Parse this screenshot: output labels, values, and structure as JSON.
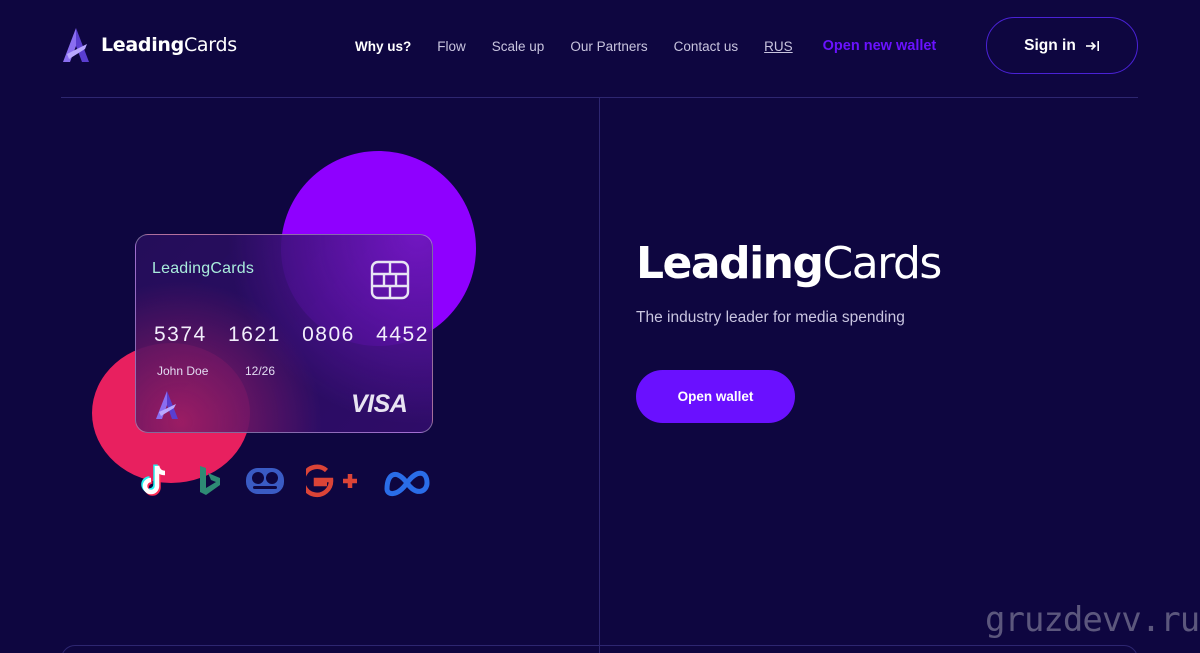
{
  "header": {
    "logo": {
      "name_bold": "Leading",
      "name_regular": "Cards"
    },
    "nav": [
      {
        "label": "Why us?"
      },
      {
        "label": "Flow"
      },
      {
        "label": "Scale up"
      },
      {
        "label": "Our Partners"
      },
      {
        "label": "Contact us"
      },
      {
        "label": "RUS"
      },
      {
        "label": "Open new wallet"
      }
    ],
    "signin_label": "Sign in"
  },
  "card": {
    "brand": "LeadingCards",
    "number": "5374 1621 0806 4452",
    "holder": "John Doe",
    "expiry": "12/26",
    "network": "VISA"
  },
  "socials": [
    "tiktok-icon",
    "bing-icon",
    "yandex-zen-icon",
    "google-plus-icon",
    "meta-icon"
  ],
  "hero": {
    "title_bold": "Leading",
    "title_regular": "Cards",
    "subtitle": "The industry leader for media spending",
    "button_label": "Open wallet"
  },
  "watermark": "gruzdevv.ru",
  "colors": {
    "background": "#0e0640",
    "accent": "#6a10ff",
    "purple_blob": "#8f00ff",
    "pink_blob": "#e8205f",
    "divider": "#2d2670"
  }
}
